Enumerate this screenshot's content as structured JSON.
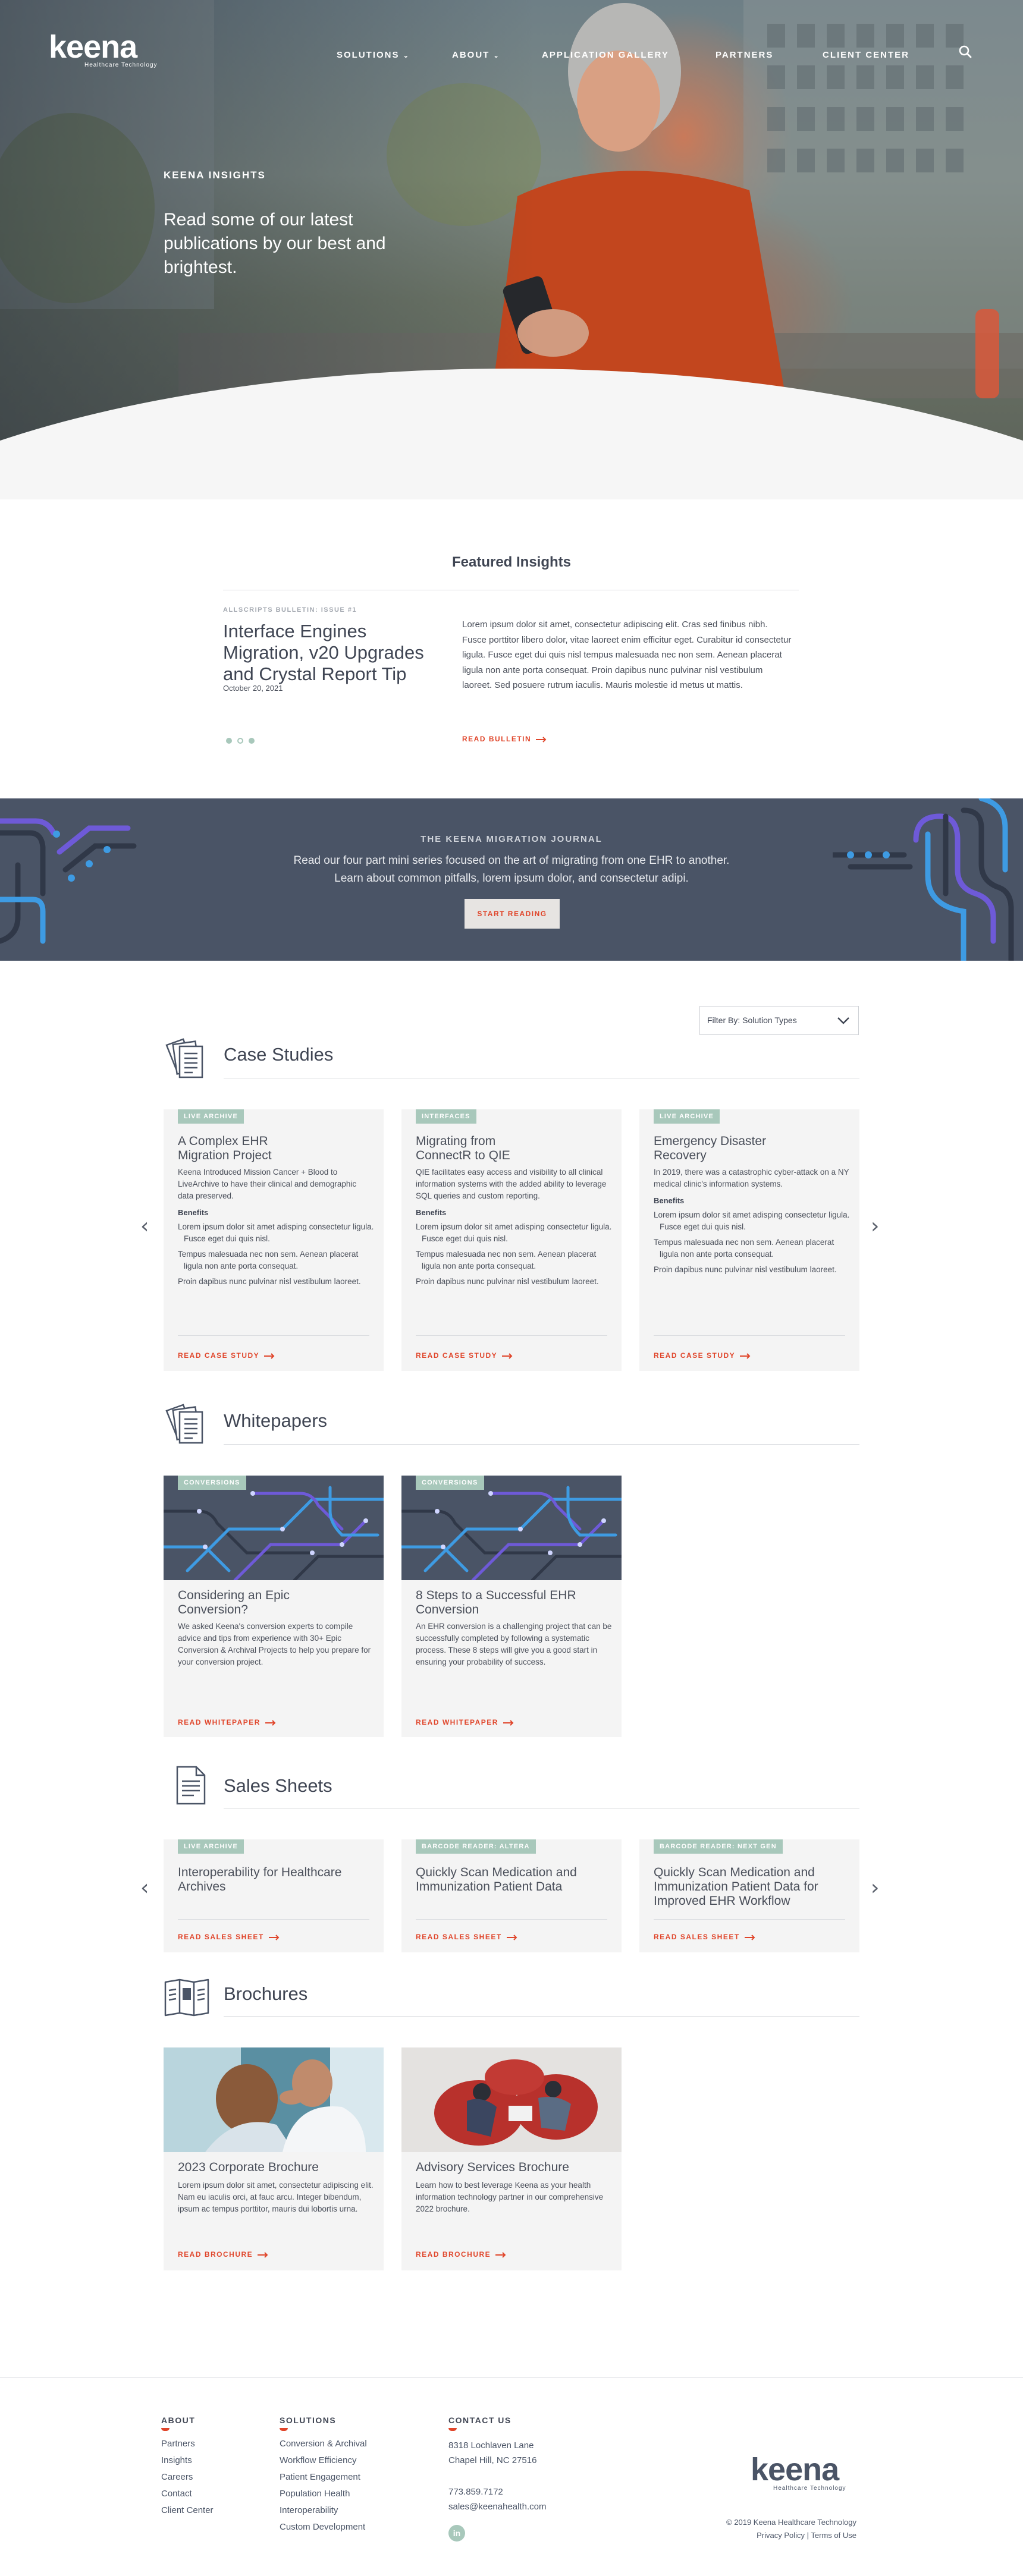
{
  "brand": {
    "name": "keena",
    "tagline": "Healthcare Technology"
  },
  "nav": {
    "items": [
      "SOLUTIONS",
      "ABOUT",
      "APPLICATION GALLERY",
      "PARTNERS",
      "CLIENT CENTER"
    ],
    "search_icon": "search-icon"
  },
  "hero": {
    "eyebrow": "KEENA INSIGHTS",
    "title": "Read some of our latest publications by our best and brightest."
  },
  "featured": {
    "title": "Featured Insights",
    "eyebrow": "ALLSCRIPTS BULLETIN: ISSUE #1",
    "headline": "Interface Engines Migration, v20 Upgrades and Crystal Report Tip",
    "date": "October 20, 2021",
    "body": "Lorem ipsum dolor sit amet, consectetur adipiscing elit. Cras sed finibus nibh. Fusce porttitor libero dolor, vitae laoreet enim efficitur eget. Curabitur id consectetur ligula. Fusce eget dui quis nisl tempus malesuada nec non sem. Aenean placerat ligula non ante porta consequat. Proin dapibus nunc pulvinar nisl vestibulum laoreet. Sed posuere rutrum iaculis. Mauris molestie id metus ut mattis.",
    "link": "READ BULLETIN",
    "slides": 3,
    "active_slide": 2
  },
  "journal": {
    "eyebrow": "THE KEENA MIGRATION JOURNAL",
    "line1": "Read our four part mini series focused on the art of migrating from one EHR to another.",
    "line2": "Learn about common pitfalls, lorem ipsum dolor, and consectetur adipi.",
    "button": "START READING"
  },
  "filter": {
    "label": "Filter By: Solution Types"
  },
  "case_studies": {
    "title": "Case Studies",
    "benefits_label": "Benefits",
    "link": "READ CASE STUDY",
    "cards": [
      {
        "badge": "LIVE ARCHIVE",
        "title": "A Complex EHR Migration Project",
        "desc": "Keena Introduced Mission Cancer + Blood to LiveArchive to have their clinical and demographic data preserved.",
        "bullets": [
          "Lorem ipsum dolor sit amet adisping consectetur ligula. Fusce eget dui quis nisl.",
          "Tempus malesuada nec non sem. Aenean placerat ligula non ante porta consequat.",
          "Proin dapibus nunc pulvinar nisl vestibulum laoreet."
        ]
      },
      {
        "badge": "INTERFACES",
        "title": "Migrating from ConnectR to QIE",
        "desc": "QIE facilitates easy access and visibility to all clinical information systems with the added ability to leverage SQL queries and custom reporting.",
        "bullets": [
          "Lorem ipsum dolor sit amet adisping consectetur ligula. Fusce eget dui quis nisl.",
          "Tempus malesuada nec non sem. Aenean placerat ligula non ante porta consequat.",
          "Proin dapibus nunc pulvinar nisl vestibulum laoreet."
        ]
      },
      {
        "badge": "LIVE ARCHIVE",
        "title": "Emergency Disaster Recovery",
        "desc": "In 2019, there was a catastrophic cyber-attack on a NY medical clinic's information systems.",
        "bullets": [
          "Lorem ipsum dolor sit amet adisping consectetur ligula. Fusce eget dui quis nisl.",
          "Tempus malesuada nec non sem. Aenean placerat ligula non ante porta consequat.",
          "Proin dapibus nunc pulvinar nisl vestibulum laoreet."
        ]
      }
    ]
  },
  "whitepapers": {
    "title": "Whitepapers",
    "link": "READ WHITEPAPER",
    "cards": [
      {
        "badge": "CONVERSIONS",
        "title": "Considering an Epic Conversion?",
        "desc": "We asked Keena's conversion experts to compile advice and tips from experience with 30+ Epic Conversion & Archival Projects to help you prepare for your conversion project."
      },
      {
        "badge": "CONVERSIONS",
        "title": "8 Steps to a Successful EHR Conversion",
        "desc": "An EHR conversion is a challenging project that can be successfully completed by following a systematic process. These 8 steps will give you a good start in ensuring your probability of success."
      }
    ]
  },
  "sales_sheets": {
    "title": "Sales Sheets",
    "link": "READ SALES SHEET",
    "cards": [
      {
        "badge": "LIVE ARCHIVE",
        "title": "Interoperability for Healthcare Archives"
      },
      {
        "badge": "BARCODE READER: ALTERA",
        "title": "Quickly Scan Medication and Immunization Patient Data"
      },
      {
        "badge": "BARCODE READER: NEXT GEN",
        "title": "Quickly Scan Medication and Immunization Patient Data for Improved EHR Workflow"
      }
    ]
  },
  "brochures": {
    "title": "Brochures",
    "link": "READ BROCHURE",
    "cards": [
      {
        "title": "2023 Corporate Brochure",
        "desc": "Lorem ipsum dolor sit amet, consectetur adipiscing elit. Nam eu iaculis orci, at fauc arcu. Integer bibendum, ipsum ac tempus porttitor, mauris dui lobortis urna."
      },
      {
        "title": "Advisory Services Brochure",
        "desc": "Learn how to best leverage Keena as your health information technology partner in our comprehensive 2022 brochure."
      }
    ]
  },
  "footer": {
    "about": {
      "heading": "ABOUT",
      "items": [
        "Partners",
        "Insights",
        "Careers",
        "Contact",
        "Client Center"
      ]
    },
    "solutions": {
      "heading": "SOLUTIONS",
      "items": [
        "Conversion & Archival",
        "Workflow Efficiency",
        "Patient Engagement",
        "Population Health",
        "Interoperability",
        "Custom Development"
      ]
    },
    "contact": {
      "heading": "CONTACT US",
      "address1": "8318 Lochlaven Lane",
      "address2": "Chapel Hill, NC 27516",
      "phone": "773.859.7172",
      "email": "sales@keenahealth.com",
      "social": "in"
    },
    "copyright": "© 2019 Keena Healthcare Technology",
    "privacy": "Privacy Policy",
    "separator": "|",
    "terms": "Terms of Use"
  },
  "colors": {
    "accent": "#e0452a",
    "band": "#4a5466",
    "badge": "#a8c8bb",
    "card": "#f4f4f4",
    "text": "#4a4f5a"
  }
}
